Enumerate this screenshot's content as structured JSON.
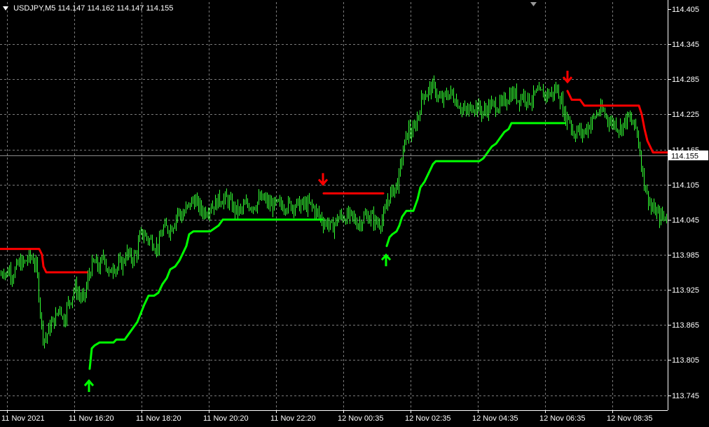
{
  "header": {
    "symbol": "USDJPY,M5",
    "ohlc": "114.147 114.162 114.147 114.155"
  },
  "colors": {
    "background": "#000000",
    "grid": "#7a7a7a",
    "candles": "#33ff33",
    "trend_up": "#00ff00",
    "trend_down": "#ff0000",
    "axis_text": "#ffffff"
  },
  "icons": {
    "buy": "arrow-up-icon",
    "sell": "arrow-down-icon"
  },
  "chart_data": {
    "type": "line",
    "symbol": "USDJPY",
    "timeframe": "M5",
    "grid": true,
    "x_tick_labels": [
      "11 Nov 2021",
      "11 Nov 16:20",
      "11 Nov 18:20",
      "11 Nov 20:20",
      "11 Nov 22:20",
      "12 Nov 00:35",
      "12 Nov 02:35",
      "12 Nov 04:35",
      "12 Nov 06:35",
      "12 Nov 08:35"
    ],
    "y_tick_labels": [
      "114.405",
      "114.345",
      "114.285",
      "114.225",
      "114.165",
      "114.105",
      "114.045",
      "113.985",
      "113.925",
      "113.865",
      "113.805",
      "113.745"
    ],
    "ylim": [
      113.725,
      114.418
    ],
    "current_price": "114.155",
    "series": [
      {
        "style": "price-bars",
        "approximate_path": [
          [
            0,
            113.95
          ],
          [
            5,
            113.96
          ],
          [
            8,
            113.95
          ],
          [
            13,
            113.96
          ],
          [
            17,
            113.95
          ],
          [
            22,
            113.96
          ],
          [
            26,
            113.97
          ],
          [
            30,
            113.97
          ],
          [
            34,
            113.97
          ],
          [
            40,
            113.98
          ],
          [
            46,
            113.98
          ],
          [
            52,
            113.96
          ],
          [
            57,
            113.89
          ],
          [
            60,
            113.85
          ],
          [
            64,
            113.84
          ],
          [
            70,
            113.86
          ],
          [
            75,
            113.87
          ],
          [
            80,
            113.88
          ],
          [
            85,
            113.9
          ],
          [
            90,
            113.87
          ],
          [
            96,
            113.9
          ],
          [
            101,
            113.91
          ],
          [
            106,
            113.93
          ],
          [
            111,
            113.92
          ],
          [
            116,
            113.91
          ],
          [
            120,
            113.91
          ],
          [
            126,
            113.95
          ],
          [
            132,
            113.97
          ],
          [
            137,
            113.97
          ],
          [
            142,
            113.96
          ],
          [
            148,
            113.99
          ],
          [
            152,
            113.96
          ],
          [
            157,
            113.95
          ],
          [
            161,
            113.97
          ],
          [
            166,
            113.96
          ],
          [
            170,
            113.97
          ],
          [
            175,
            113.97
          ],
          [
            180,
            113.99
          ],
          [
            184,
            113.98
          ],
          [
            190,
            113.98
          ],
          [
            195,
            113.99
          ],
          [
            200,
            114.02
          ],
          [
            206,
            114.02
          ],
          [
            212,
            114.01
          ],
          [
            216,
            114.01
          ],
          [
            221,
            114.0
          ],
          [
            226,
            114.0
          ],
          [
            232,
            114.03
          ],
          [
            238,
            114.03
          ],
          [
            243,
            114.03
          ],
          [
            248,
            114.04
          ],
          [
            253,
            114.06
          ],
          [
            259,
            114.05
          ],
          [
            264,
            114.06
          ],
          [
            270,
            114.07
          ],
          [
            276,
            114.08
          ],
          [
            282,
            114.07
          ],
          [
            288,
            114.06
          ],
          [
            294,
            114.06
          ],
          [
            300,
            114.07
          ],
          [
            306,
            114.07
          ],
          [
            312,
            114.08
          ],
          [
            318,
            114.08
          ],
          [
            324,
            114.08
          ],
          [
            330,
            114.07
          ],
          [
            337,
            114.06
          ],
          [
            344,
            114.06
          ],
          [
            350,
            114.07
          ],
          [
            357,
            114.07
          ],
          [
            364,
            114.07
          ],
          [
            370,
            114.08
          ],
          [
            377,
            114.08
          ],
          [
            384,
            114.07
          ],
          [
            390,
            114.07
          ],
          [
            398,
            114.07
          ],
          [
            405,
            114.07
          ],
          [
            412,
            114.07
          ],
          [
            420,
            114.07
          ],
          [
            428,
            114.07
          ],
          [
            436,
            114.07
          ],
          [
            443,
            114.07
          ],
          [
            450,
            114.06
          ],
          [
            456,
            114.05
          ],
          [
            462,
            114.04
          ],
          [
            468,
            114.04
          ],
          [
            473,
            114.03
          ],
          [
            478,
            114.04
          ],
          [
            484,
            114.05
          ],
          [
            490,
            114.05
          ],
          [
            496,
            114.05
          ],
          [
            502,
            114.05
          ],
          [
            508,
            114.04
          ],
          [
            514,
            114.04
          ],
          [
            519,
            114.05
          ],
          [
            524,
            114.05
          ],
          [
            530,
            114.05
          ],
          [
            536,
            114.04
          ],
          [
            542,
            114.04
          ],
          [
            548,
            114.05
          ],
          [
            553,
            114.08
          ],
          [
            558,
            114.09
          ],
          [
            563,
            114.1
          ],
          [
            568,
            114.11
          ],
          [
            573,
            114.15
          ],
          [
            578,
            114.18
          ],
          [
            583,
            114.2
          ],
          [
            588,
            114.19
          ],
          [
            593,
            114.21
          ],
          [
            598,
            114.23
          ],
          [
            603,
            114.26
          ],
          [
            608,
            114.26
          ],
          [
            614,
            114.27
          ],
          [
            620,
            114.27
          ],
          [
            626,
            114.25
          ],
          [
            632,
            114.25
          ],
          [
            638,
            114.26
          ],
          [
            644,
            114.26
          ],
          [
            650,
            114.25
          ],
          [
            656,
            114.24
          ],
          [
            662,
            114.23
          ],
          [
            668,
            114.23
          ],
          [
            674,
            114.24
          ],
          [
            680,
            114.24
          ],
          [
            686,
            114.23
          ],
          [
            692,
            114.23
          ],
          [
            698,
            114.24
          ],
          [
            704,
            114.24
          ],
          [
            710,
            114.24
          ],
          [
            716,
            114.24
          ],
          [
            722,
            114.25
          ],
          [
            728,
            114.26
          ],
          [
            734,
            114.26
          ],
          [
            740,
            114.25
          ],
          [
            746,
            114.26
          ],
          [
            752,
            114.25
          ],
          [
            758,
            114.25
          ],
          [
            764,
            114.26
          ],
          [
            770,
            114.26
          ],
          [
            776,
            114.26
          ],
          [
            782,
            114.26
          ],
          [
            788,
            114.26
          ],
          [
            794,
            114.27
          ],
          [
            800,
            114.25
          ],
          [
            806,
            114.22
          ],
          [
            812,
            114.22
          ],
          [
            818,
            114.19
          ],
          [
            824,
            114.2
          ],
          [
            830,
            114.19
          ],
          [
            836,
            114.2
          ],
          [
            842,
            114.21
          ],
          [
            848,
            114.22
          ],
          [
            854,
            114.23
          ],
          [
            860,
            114.23
          ],
          [
            866,
            114.22
          ],
          [
            872,
            114.21
          ],
          [
            878,
            114.21
          ],
          [
            884,
            114.2
          ],
          [
            890,
            114.21
          ],
          [
            896,
            114.22
          ],
          [
            902,
            114.21
          ],
          [
            908,
            114.2
          ],
          [
            912,
            114.17
          ],
          [
            915,
            114.14
          ],
          [
            918,
            114.12
          ],
          [
            922,
            114.09
          ],
          [
            926,
            114.08
          ],
          [
            930,
            114.06
          ],
          [
            935,
            114.06
          ],
          [
            940,
            114.05
          ],
          [
            945,
            114.05
          ],
          [
            950,
            114.05
          ]
        ]
      },
      {
        "style": "trend-up",
        "segments": [
          [
            [
              128,
              113.79
            ],
            [
              131,
              113.825
            ],
            [
              135,
              113.83
            ],
            [
              142,
              113.835
            ],
            [
              162,
              113.835
            ],
            [
              166,
              113.84
            ],
            [
              178,
              113.84
            ],
            [
              184,
              113.85
            ],
            [
              190,
              113.86
            ],
            [
              196,
              113.87
            ],
            [
              201,
              113.885
            ],
            [
              206,
              113.9
            ],
            [
              212,
              113.915
            ],
            [
              220,
              113.915
            ],
            [
              226,
              113.92
            ],
            [
              232,
              113.935
            ],
            [
              238,
              113.945
            ],
            [
              243,
              113.96
            ],
            [
              250,
              113.965
            ],
            [
              256,
              113.975
            ],
            [
              262,
              113.99
            ],
            [
              266,
              114.0
            ],
            [
              270,
              114.02
            ],
            [
              276,
              114.025
            ],
            [
              300,
              114.025
            ],
            [
              306,
              114.03
            ],
            [
              312,
              114.035
            ],
            [
              318,
              114.045
            ],
            [
              460,
              114.045
            ]
          ],
          [
            [
              552,
              114.0
            ],
            [
              556,
              114.015
            ],
            [
              560,
              114.02
            ],
            [
              566,
              114.025
            ],
            [
              570,
              114.035
            ],
            [
              574,
              114.05
            ],
            [
              580,
              114.06
            ],
            [
              590,
              114.06
            ],
            [
              596,
              114.08
            ],
            [
              600,
              114.1
            ],
            [
              606,
              114.11
            ],
            [
              610,
              114.12
            ],
            [
              614,
              114.13
            ],
            [
              618,
              114.14
            ],
            [
              622,
              114.145
            ],
            [
              684,
              114.145
            ],
            [
              690,
              114.15
            ],
            [
              696,
              114.16
            ],
            [
              702,
              114.17
            ],
            [
              708,
              114.175
            ],
            [
              714,
              114.185
            ],
            [
              720,
              114.195
            ],
            [
              726,
              114.2
            ],
            [
              730,
              114.21
            ],
            [
              806,
              114.21
            ]
          ]
        ]
      },
      {
        "style": "trend-down",
        "segments": [
          [
            [
              0,
              113.995
            ],
            [
              56,
              113.995
            ],
            [
              60,
              113.985
            ],
            [
              62,
              113.965
            ],
            [
              66,
              113.955
            ],
            [
              124,
              113.955
            ]
          ],
          [
            [
              462,
              114.09
            ],
            [
              547,
              114.09
            ]
          ],
          [
            [
              810,
              114.265
            ],
            [
              816,
              114.25
            ],
            [
              828,
              114.25
            ],
            [
              834,
              114.24
            ],
            [
              912,
              114.24
            ],
            [
              916,
              114.225
            ],
            [
              920,
              114.2
            ],
            [
              924,
              114.18
            ],
            [
              928,
              114.17
            ],
            [
              932,
              114.16
            ],
            [
              954,
              114.16
            ]
          ]
        ]
      }
    ],
    "signals": [
      {
        "type": "buy",
        "x": 127,
        "price": 113.76
      },
      {
        "type": "sell",
        "x": 461,
        "price": 114.115
      },
      {
        "type": "buy",
        "x": 551,
        "price": 113.975
      },
      {
        "type": "sell",
        "x": 810,
        "price": 114.29
      }
    ]
  }
}
